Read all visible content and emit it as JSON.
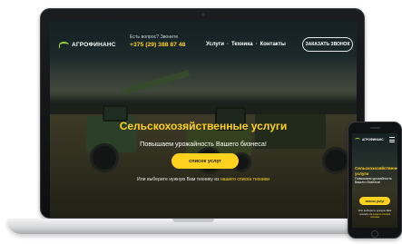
{
  "site": {
    "logo": "АГРОФИНАНС",
    "contact_question": "Есть вопрос? Звоните",
    "phone": "+375 (29) 388 87 48",
    "nav": [
      "Услуги",
      "Техника",
      "Контакты"
    ],
    "nav_separator": "·",
    "cta_top": "ЗАКАЗАТЬ ЗВОНОК"
  },
  "hero": {
    "title": "Сельскохозяйственные услуги",
    "subtitle": "Повышаем урожайность Вашего бизнеса!",
    "button": "список услуг",
    "note_prefix": "Или выберите нужную Вам технику из ",
    "note_link": "нашего списка техники"
  },
  "mobile": {
    "logo": "АГРОФИНАНС",
    "title": "Сельскохозяйственные услуги",
    "subtitle": "Повышаем урожайность Вашего бизнеса!",
    "button": "список услуг",
    "note_prefix": "Или выберите нужную Вам технику из ",
    "note_link": "нашего списка техники"
  },
  "colors": {
    "accent_yellow": "#ffd21f",
    "logo_green": "#9bd33b",
    "device_dark": "#111214"
  },
  "icons": {
    "logo": "leaf-arc-icon",
    "mobile_menu": "hamburger-menu-icon"
  }
}
